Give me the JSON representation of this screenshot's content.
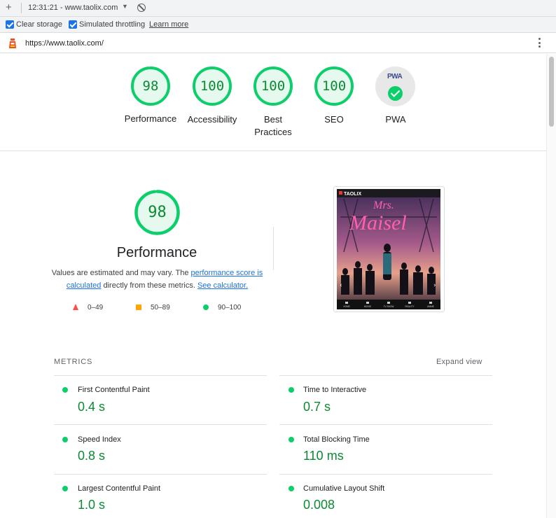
{
  "toolbar": {
    "new_icon": "plus-icon",
    "session_label": "12:31:21 - www.taolix.com",
    "dropdown_icon": "caret-down-icon",
    "clear_icon": "block-icon"
  },
  "options": {
    "clear_storage_label": "Clear storage",
    "clear_storage_checked": true,
    "throttling_label": "Simulated throttling",
    "throttling_checked": true,
    "learn_more": "Learn more"
  },
  "urlbar": {
    "url": "https://www.taolix.com/",
    "menu_icon": "kebab-menu-icon"
  },
  "scores": [
    {
      "label": "Performance",
      "score": "98",
      "value": 98,
      "color": "#0cce6b"
    },
    {
      "label": "Accessibility",
      "score": "100",
      "value": 100,
      "color": "#0cce6b"
    },
    {
      "label": "Best Practices",
      "score": "100",
      "value": 100,
      "color": "#0cce6b"
    },
    {
      "label": "SEO",
      "score": "100",
      "value": 100,
      "color": "#0cce6b"
    },
    {
      "label": "PWA",
      "badge_text": "PWA",
      "badge_icon": "check-circle-icon"
    }
  ],
  "performance": {
    "score": "98",
    "value": 98,
    "title": "Performance",
    "desc_start": "Values are estimated and may vary. The ",
    "desc_link1": "performance score is calculated",
    "desc_mid": " directly from these metrics. ",
    "desc_link2": "See calculator.",
    "legend": [
      {
        "icon": "triangle-red-icon",
        "range": "0–49",
        "color": "#ff4e42"
      },
      {
        "icon": "square-orange-icon",
        "range": "50–89",
        "color": "#ffa400"
      },
      {
        "icon": "circle-green-icon",
        "range": "90–100",
        "color": "#0cce6b"
      }
    ]
  },
  "screenshot": {
    "brand": "TAOLIX",
    "title_top": "Mrs.",
    "title_main": "Maisel",
    "nav": [
      "HOME",
      "MOVIE",
      "TV SHOW",
      "REALITY",
      "ANIME"
    ]
  },
  "metrics": {
    "heading": "METRICS",
    "expand_label": "Expand view",
    "items": [
      {
        "name": "First Contentful Paint",
        "value": "0.4 s"
      },
      {
        "name": "Time to Interactive",
        "value": "0.7 s"
      },
      {
        "name": "Speed Index",
        "value": "0.8 s"
      },
      {
        "name": "Total Blocking Time",
        "value": "110 ms"
      },
      {
        "name": "Largest Contentful Paint",
        "value": "1.0 s"
      },
      {
        "name": "Cumulative Layout Shift",
        "value": "0.008"
      }
    ],
    "status_color": "#0cce6b"
  }
}
